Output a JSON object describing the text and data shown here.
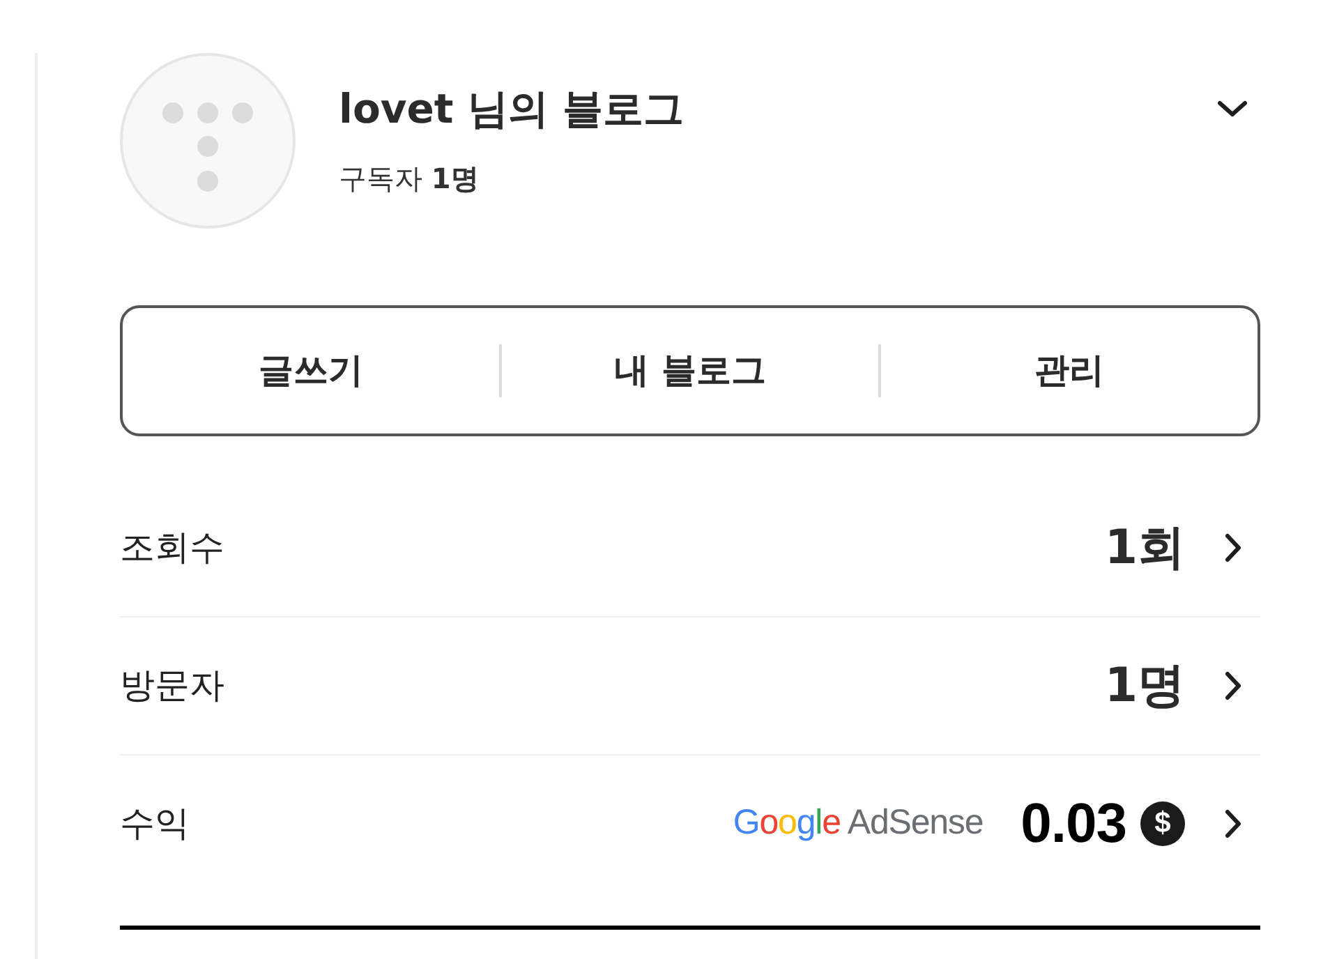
{
  "blog": {
    "title": "lovet 님의 블로그",
    "subscribers": "구독자 **1명**"
  },
  "actions": [
    {
      "label": "글쓰기"
    },
    {
      "label": "내 블로그"
    },
    {
      "label": "관리"
    }
  ],
  "stats": [
    {
      "kind": "count",
      "label": "조회수",
      "value": "1회"
    },
    {
      "kind": "count",
      "label": "방문자",
      "value": "1명"
    },
    {
      "kind": "revenue",
      "label": "수익",
      "provider": {
        "brand": "Google",
        "product": "AdSense"
      },
      "value": "0.03",
      "currency": "$"
    }
  ]
}
